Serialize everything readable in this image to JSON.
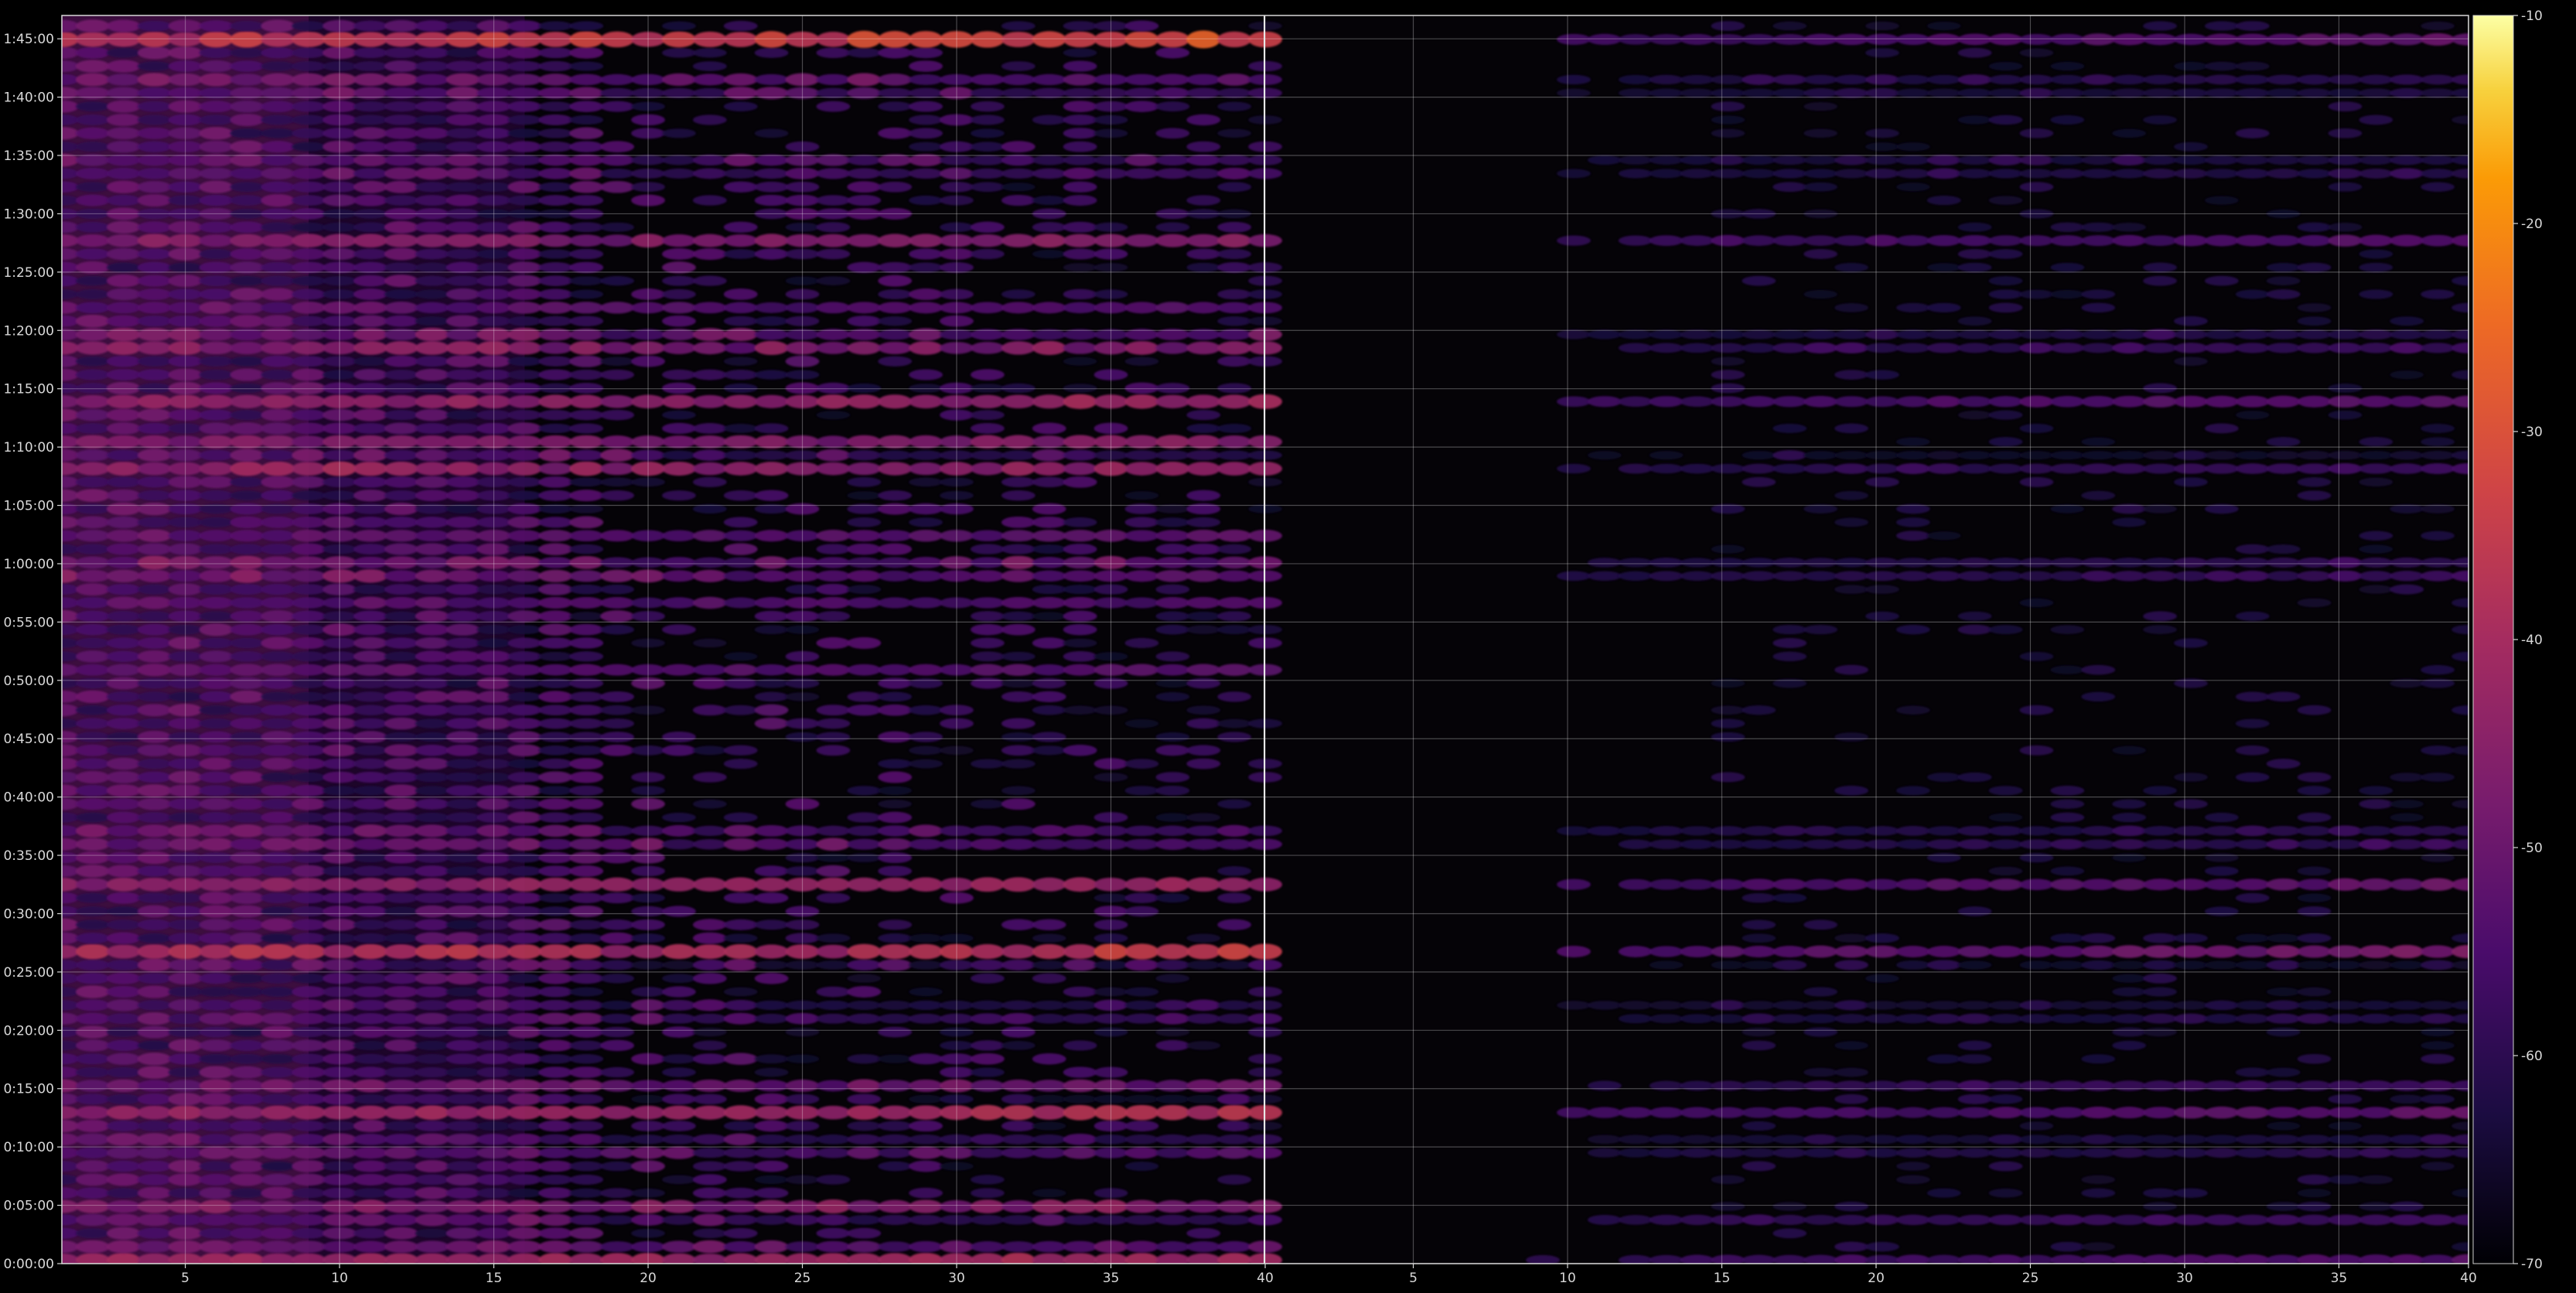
{
  "chart_data": {
    "type": "heatmap",
    "title": "",
    "xlabel": "",
    "ylabel": "",
    "grid": true,
    "x_tick_labels": [
      "5",
      "10",
      "15",
      "20",
      "25",
      "30",
      "35",
      "40",
      "5",
      "10",
      "15",
      "20",
      "25",
      "30",
      "35",
      "40"
    ],
    "y_tick_labels": [
      "0:00:00",
      "0:05:00",
      "0:10:00",
      "0:15:00",
      "0:20:00",
      "0:25:00",
      "0:30:00",
      "0:35:00",
      "0:40:00",
      "0:45:00",
      "0:50:00",
      "0:55:00",
      "1:00:00",
      "1:05:00",
      "1:10:00",
      "1:15:00",
      "1:20:00",
      "1:25:00",
      "1:30:00",
      "1:35:00",
      "1:40:00",
      "1:45:00"
    ],
    "xlim": [
      1,
      79
    ],
    "ylim_minutes": [
      0,
      107
    ],
    "colorbar": {
      "colormap": "inferno",
      "range": [
        -70,
        -10
      ],
      "ticks": [
        "-10",
        "-20",
        "-30",
        "-40",
        "-50",
        "-60",
        "-70"
      ]
    },
    "panels": [
      {
        "x_range": [
          1,
          40
        ],
        "description_values": "left channel group — broad activity at low x, strong bursts across all columns",
        "hot_rows_minutes": [
          {
            "t": 0,
            "level": -28
          },
          {
            "t": 1,
            "level": -42
          },
          {
            "t": 4.5,
            "level": -33
          },
          {
            "t": 10,
            "level": -45
          },
          {
            "t": 13,
            "level": -36
          },
          {
            "t": 15,
            "level": -44
          },
          {
            "t": 21.5,
            "level": -50
          },
          {
            "t": 26.5,
            "level": -25
          },
          {
            "t": 32.5,
            "level": -40
          },
          {
            "t": 36.5,
            "level": -40
          },
          {
            "t": 51,
            "level": -50
          },
          {
            "t": 56.5,
            "level": -52
          },
          {
            "t": 59.5,
            "level": -33
          },
          {
            "t": 62.5,
            "level": -50
          },
          {
            "t": 68.5,
            "level": -30
          },
          {
            "t": 70.5,
            "level": -43
          },
          {
            "t": 74,
            "level": -38
          },
          {
            "t": 79,
            "level": -28
          },
          {
            "t": 82,
            "level": -52
          },
          {
            "t": 87.5,
            "level": -40
          },
          {
            "t": 94,
            "level": -45
          },
          {
            "t": 101,
            "level": -40
          },
          {
            "t": 105,
            "level": -27
          }
        ]
      },
      {
        "x_range": [
          41,
          79
        ],
        "description_values": "right channel group — activity mainly at high x",
        "hot_rows_minutes": [
          {
            "t": 0.5,
            "level": -50
          },
          {
            "t": 4,
            "level": -52
          },
          {
            "t": 10,
            "level": -52
          },
          {
            "t": 13,
            "level": -50
          },
          {
            "t": 15,
            "level": -52
          },
          {
            "t": 21.5,
            "level": -55
          },
          {
            "t": 26.5,
            "level": -40
          },
          {
            "t": 32.5,
            "level": -50
          },
          {
            "t": 36.5,
            "level": -48
          },
          {
            "t": 59.5,
            "level": -46
          },
          {
            "t": 68.5,
            "level": -52
          },
          {
            "t": 74,
            "level": -50
          },
          {
            "t": 79,
            "level": -47
          },
          {
            "t": 87.5,
            "level": -50
          },
          {
            "t": 94,
            "level": -52
          },
          {
            "t": 101,
            "level": -52
          },
          {
            "t": 105,
            "level": -50
          }
        ]
      }
    ]
  }
}
